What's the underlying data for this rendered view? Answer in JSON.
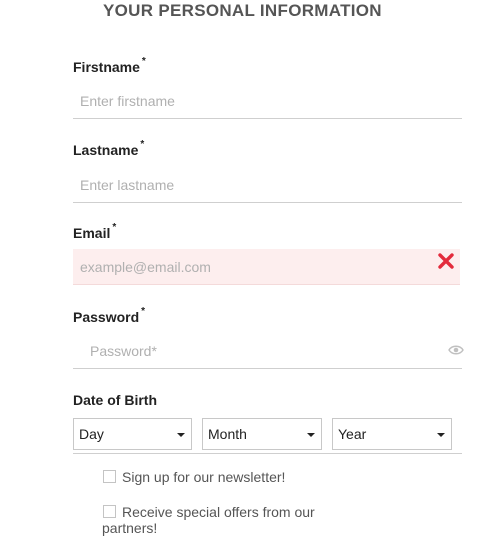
{
  "section": {
    "title": "YOUR PERSONAL INFORMATION"
  },
  "required_marker": "*",
  "fields": {
    "firstname": {
      "label": "Firstname",
      "placeholder": "Enter firstname",
      "value": ""
    },
    "lastname": {
      "label": "Lastname",
      "placeholder": "Enter lastname",
      "value": ""
    },
    "email": {
      "label": "Email",
      "placeholder": "example@email.com",
      "value": "",
      "state": "error"
    },
    "password": {
      "label": "Password",
      "placeholder": "Password*",
      "value": ""
    }
  },
  "dob": {
    "label": "Date of Birth",
    "day": "Day",
    "month": "Month",
    "year": "Year"
  },
  "options": {
    "newsletter": {
      "label": "Sign up for our newsletter!",
      "checked": false
    },
    "partners": {
      "label": "Receive special offers from our partners!",
      "checked": false
    }
  },
  "colors": {
    "error_background": "#fdeeee",
    "error_icon": "#e32b3c",
    "placeholder": "#b0b0b0"
  },
  "icons": {
    "email_error": "close-icon",
    "password_visibility": "eye-icon",
    "select_caret": "caret-down-icon"
  }
}
